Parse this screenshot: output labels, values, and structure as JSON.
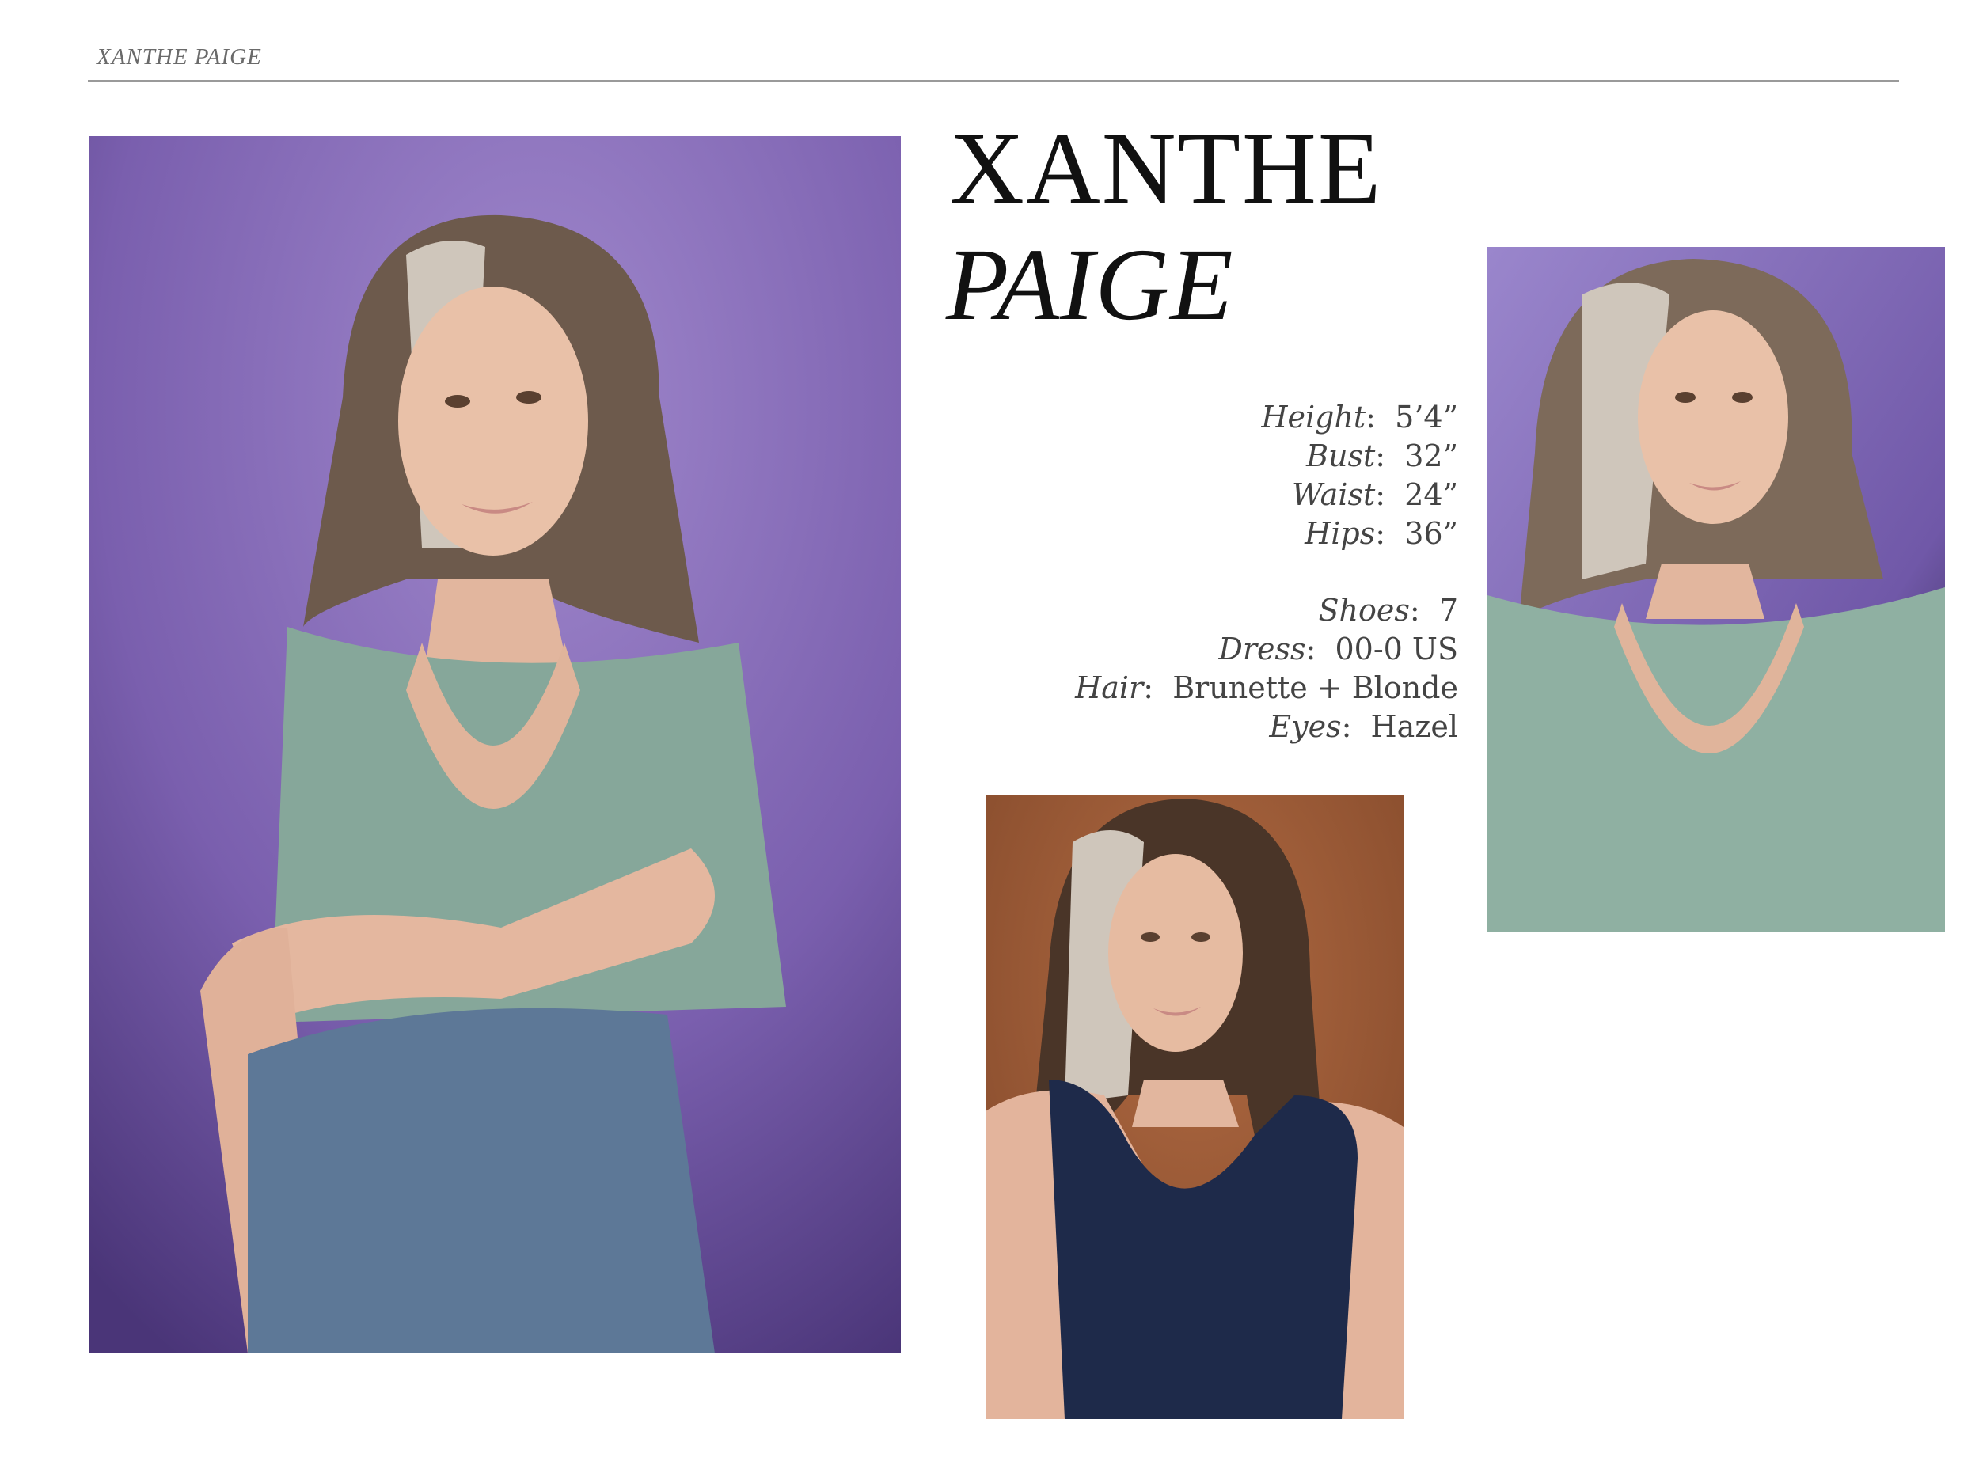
{
  "header": {
    "name": "XANTHE PAIGE"
  },
  "title": {
    "first": "XANTHE",
    "last": "PAIGE"
  },
  "measurements": [
    {
      "label": "Height",
      "value": "5’4”"
    },
    {
      "label": "Bust",
      "value": "32”"
    },
    {
      "label": "Waist",
      "value": "24”"
    },
    {
      "label": "Hips",
      "value": "36”"
    }
  ],
  "details": [
    {
      "label": "Shoes",
      "value": "7"
    },
    {
      "label": "Dress",
      "value": "00-0 US"
    },
    {
      "label": "Hair",
      "value": "Brunette + Blonde"
    },
    {
      "label": "Eyes",
      "value": "Hazel"
    }
  ],
  "photos": {
    "main": {
      "subject": "seated portrait, sage green top and jeans",
      "background": "#8a72b8"
    },
    "right": {
      "subject": "headshot, sage green top",
      "background": "#8d79c2"
    },
    "bottom": {
      "subject": "headshot, navy tank top",
      "background": "#9a5f3c"
    }
  }
}
